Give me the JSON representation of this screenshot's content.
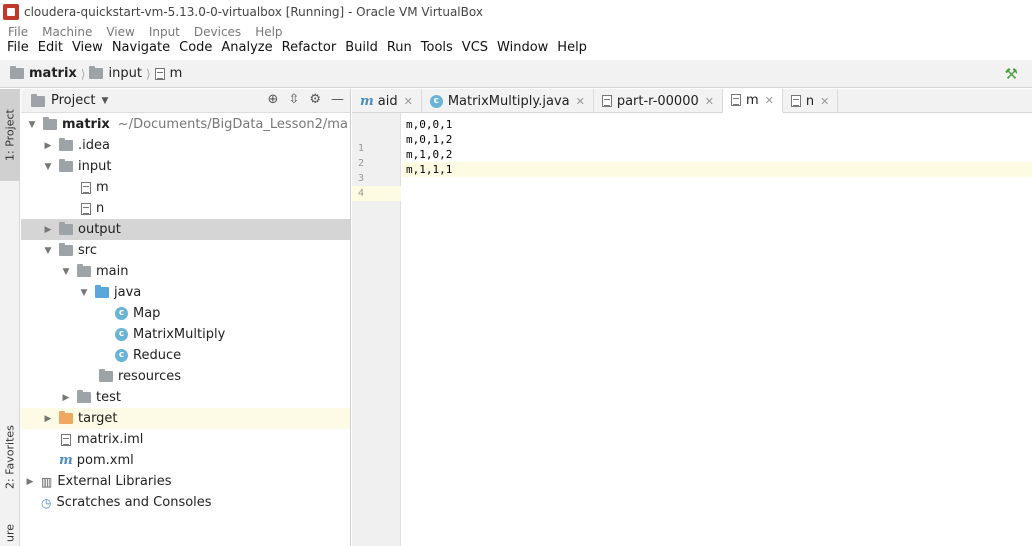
{
  "window": {
    "title": "cloudera-quickstart-vm-5.13.0-0-virtualbox [Running] - Oracle VM VirtualBox"
  },
  "vbox_menu": [
    "File",
    "Machine",
    "View",
    "Input",
    "Devices",
    "Help"
  ],
  "ide_menu": [
    "File",
    "Edit",
    "View",
    "Navigate",
    "Code",
    "Analyze",
    "Refactor",
    "Build",
    "Run",
    "Tools",
    "VCS",
    "Window",
    "Help"
  ],
  "breadcrumb": [
    "matrix",
    "input",
    "m"
  ],
  "side_tabs": {
    "project": "1: Project",
    "favorites": "2: Favorites",
    "structure": "ure"
  },
  "project_panel": {
    "title": "Project",
    "root": {
      "name": "matrix",
      "path": "~/Documents/BigData_Lesson2/ma"
    },
    "items": [
      {
        "label": ".idea"
      },
      {
        "label": "input"
      },
      {
        "label": "m"
      },
      {
        "label": "n"
      },
      {
        "label": "output"
      },
      {
        "label": "src"
      },
      {
        "label": "main"
      },
      {
        "label": "java"
      },
      {
        "label": "Map"
      },
      {
        "label": "MatrixMultiply"
      },
      {
        "label": "Reduce"
      },
      {
        "label": "resources"
      },
      {
        "label": "test"
      },
      {
        "label": "target"
      },
      {
        "label": "matrix.iml"
      },
      {
        "label": "pom.xml"
      },
      {
        "label": "External Libraries"
      },
      {
        "label": "Scratches and Consoles"
      }
    ]
  },
  "editor_tabs": [
    "aid",
    "MatrixMultiply.java",
    "part-r-00000",
    "m",
    "n"
  ],
  "editor": {
    "line_numbers": [
      "1",
      "2",
      "3",
      "4"
    ],
    "lines": [
      "m,0,0,1",
      "m,0,1,2",
      "m,1,0,2",
      "m,1,1,1"
    ]
  },
  "colors": {
    "accent_blue": "#4b8ec9",
    "selection": "#d5d5d5",
    "current_line": "#fefbe3"
  }
}
